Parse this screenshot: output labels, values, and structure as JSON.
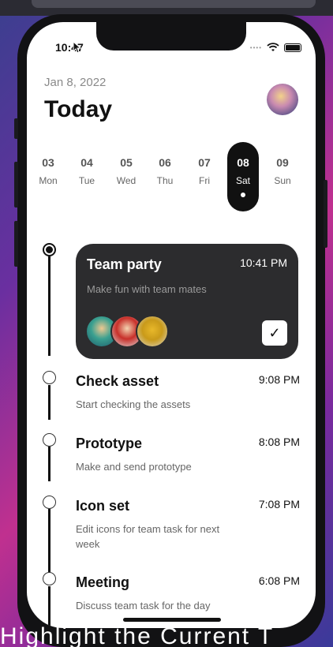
{
  "status": {
    "time": "10:47"
  },
  "header": {
    "date": "Jan 8, 2022",
    "title": "Today"
  },
  "week": [
    {
      "num": "03",
      "name": "Mon",
      "active": false
    },
    {
      "num": "04",
      "name": "Tue",
      "active": false
    },
    {
      "num": "05",
      "name": "Wed",
      "active": false
    },
    {
      "num": "06",
      "name": "Thu",
      "active": false
    },
    {
      "num": "07",
      "name": "Fri",
      "active": false
    },
    {
      "num": "08",
      "name": "Sat",
      "active": true
    },
    {
      "num": "09",
      "name": "Sun",
      "active": false
    }
  ],
  "tasks": [
    {
      "title": "Team party",
      "time": "10:41 PM",
      "desc": "Make fun with team mates",
      "highlighted": true,
      "completed": true
    },
    {
      "title": "Check asset",
      "time": "9:08 PM",
      "desc": "Start checking the assets"
    },
    {
      "title": "Prototype",
      "time": "8:08 PM",
      "desc": "Make and send prototype"
    },
    {
      "title": "Icon set",
      "time": "7:08 PM",
      "desc": "Edit icons for team task for next week"
    },
    {
      "title": "Meeting",
      "time": "6:08 PM",
      "desc": "Discuss team task for the day"
    }
  ],
  "caption": "Highlight the Current T",
  "colors": {
    "card": "#2c2c2e",
    "accent": "#111111",
    "muted": "#666666"
  }
}
